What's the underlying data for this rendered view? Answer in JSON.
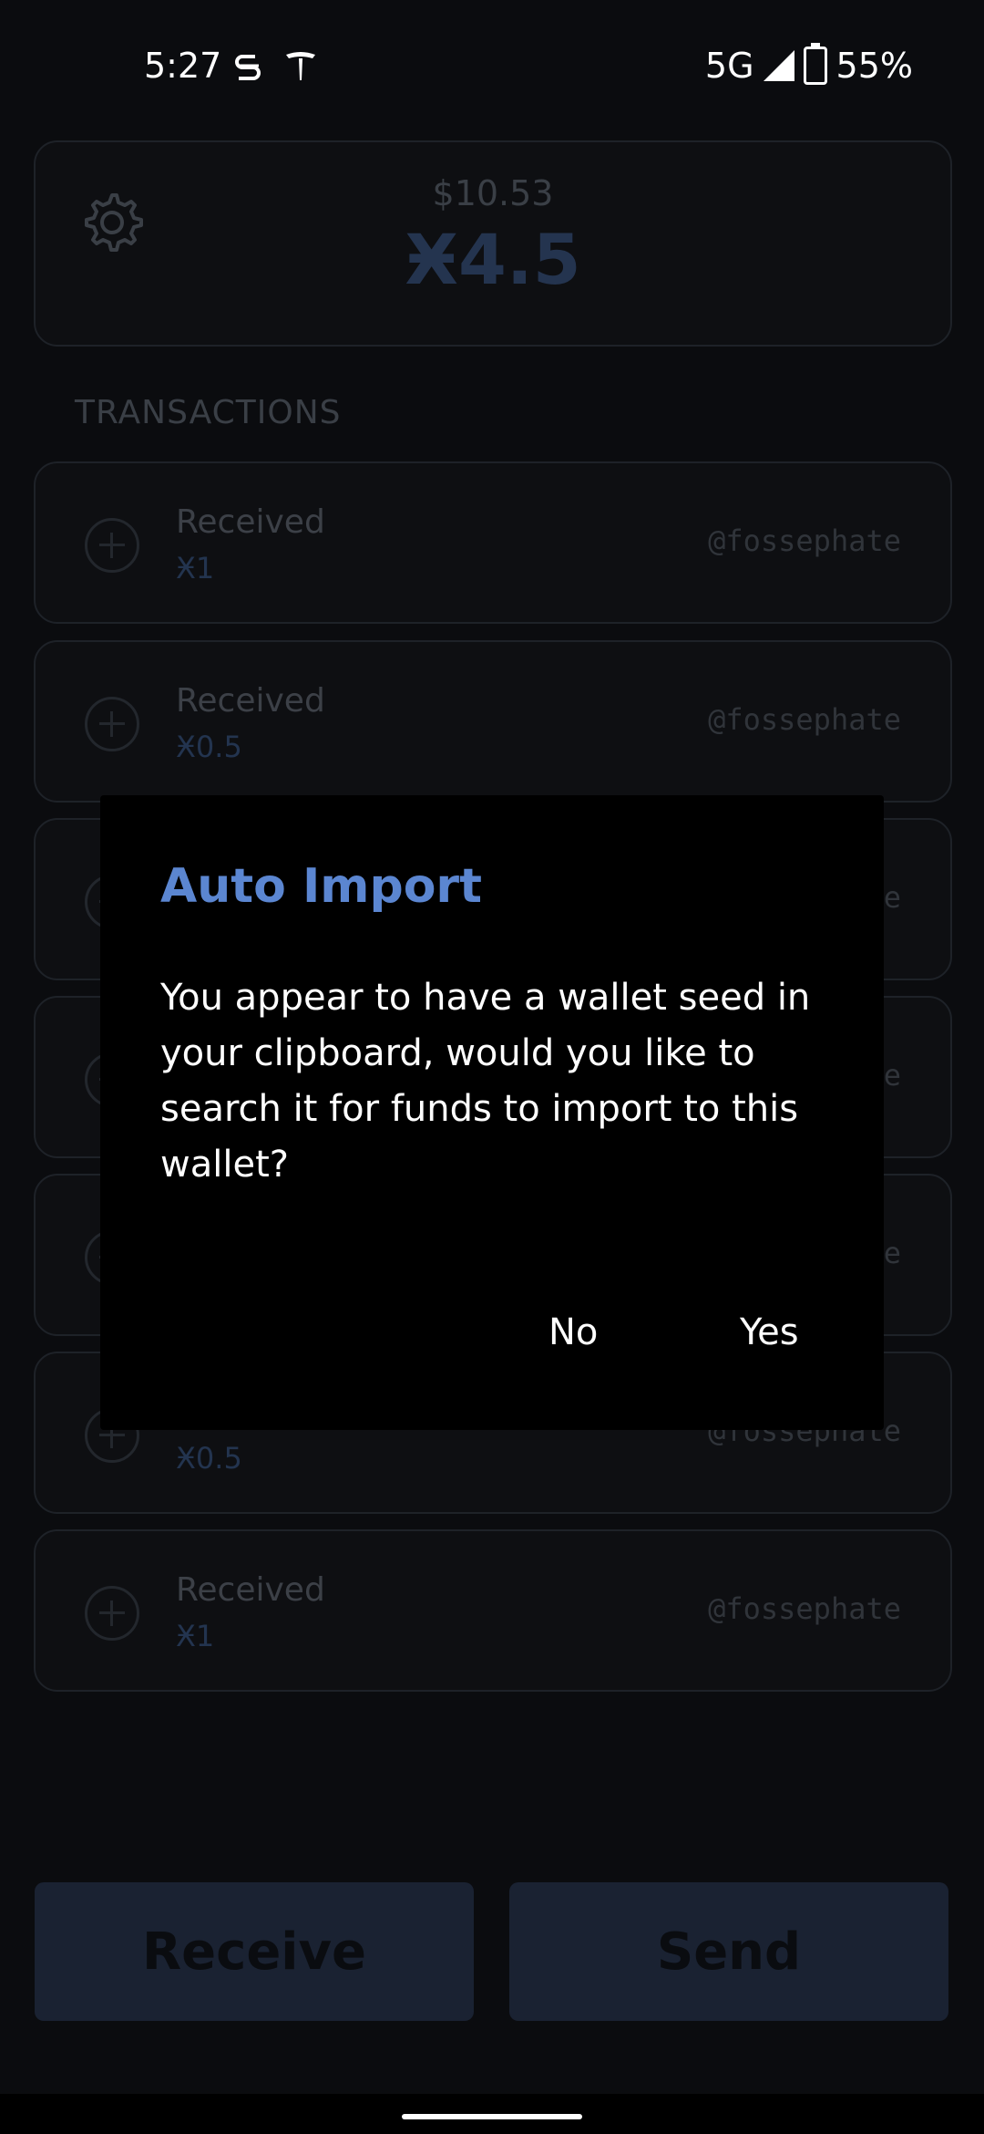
{
  "status_bar": {
    "time": "5:27",
    "network": "5G",
    "battery": "55%"
  },
  "balance": {
    "fiat": "$10.53",
    "amount": "Ӿ4.5"
  },
  "section": {
    "transactions_label": "TRANSACTIONS"
  },
  "transactions": [
    {
      "title": "Received",
      "amount": "Ӿ1",
      "user": "@fossephate"
    },
    {
      "title": "Received",
      "amount": "Ӿ0.5",
      "user": "@fossephate"
    },
    {
      "title": "",
      "amount": "",
      "user": "e"
    },
    {
      "title": "",
      "amount": "",
      "user": "e"
    },
    {
      "title": "",
      "amount": "",
      "user": "e"
    },
    {
      "title": "",
      "amount": "Ӿ0.5",
      "user": "@fossephate"
    },
    {
      "title": "Received",
      "amount": "Ӿ1",
      "user": "@fossephate"
    }
  ],
  "dialog": {
    "title": "Auto Import",
    "body": "You appear to have a wallet seed in your clipboard, would you like to search it for funds to import to this wallet?",
    "no_label": "No",
    "yes_label": "Yes"
  },
  "buttons": {
    "receive": "Receive",
    "send": "Send"
  },
  "colors": {
    "accent": "#5b86d1",
    "background": "#0b0c0f",
    "dialog_bg": "#000000"
  }
}
